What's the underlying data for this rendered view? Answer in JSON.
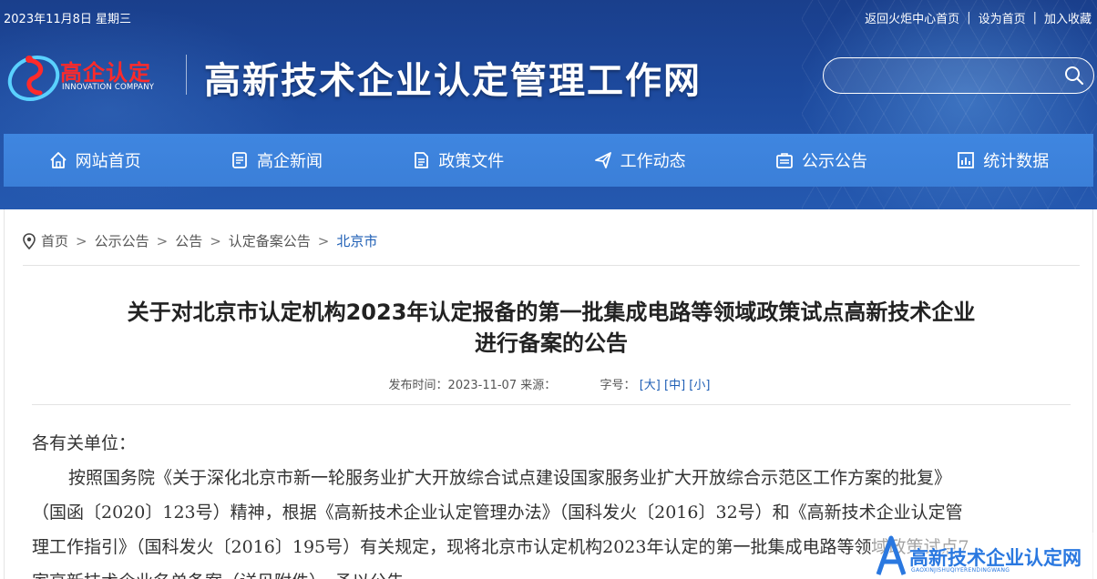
{
  "header": {
    "date": "2023年11月8日 星期三",
    "links": [
      "返回火炬中心首页",
      "设为首页",
      "加入收藏"
    ],
    "logo_cn": "高企认定",
    "logo_en": "INNOVATION COMPANY",
    "site_title": "高新技术企业认定管理工作网",
    "search_placeholder": ""
  },
  "nav": {
    "items": [
      {
        "label": "网站首页",
        "icon": "home-icon"
      },
      {
        "label": "高企新闻",
        "icon": "news-icon"
      },
      {
        "label": "政策文件",
        "icon": "document-icon"
      },
      {
        "label": "工作动态",
        "icon": "send-icon"
      },
      {
        "label": "公示公告",
        "icon": "notice-icon"
      },
      {
        "label": "统计数据",
        "icon": "chart-icon"
      }
    ]
  },
  "breadcrumb": {
    "items": [
      "首页",
      "公示公告",
      "公告",
      "认定备案公告",
      "北京市"
    ]
  },
  "article": {
    "title_line1": "关于对北京市认定机构2023年认定报备的第一批集成电路等领域政策试点高新技术企业",
    "title_line2": "进行备案的公告",
    "publish_label": "发布时间：",
    "publish_date": "2023-11-07",
    "source_label": "来源：",
    "font_label": "字号：",
    "font_sizes": [
      "[大]",
      "[中]",
      "[小]"
    ],
    "salutation": "各有关单位：",
    "para1_line1": "按照国务院《关于深化北京市新一轮服务业扩大开放综合试点建设国家服务业扩大开放综合示范区工作方案的批复》",
    "para1_line2": "（国函〔2020〕123号）精神，根据《高新技术企业认定管理办法》（国科发火〔2016〕32号）和《高新技术企业认定管",
    "para1_line3": "理工作指引》（国科发火〔2016〕195号）有关规定，现将北京市认定机构2023年认定的第一批集成电路等领域政策试点7",
    "para1_line4": "家高新技术企业名单备案（详见附件），予以公告。"
  },
  "watermark": {
    "text": "高新技术企业认定网",
    "sub": "GAOXINJISHUQIYERENDINGWANG"
  },
  "colors": {
    "banner": "#1d4a9e",
    "nav": "#3f86e0",
    "link": "#1f5fb5",
    "logo_red": "#ff2a2a"
  }
}
